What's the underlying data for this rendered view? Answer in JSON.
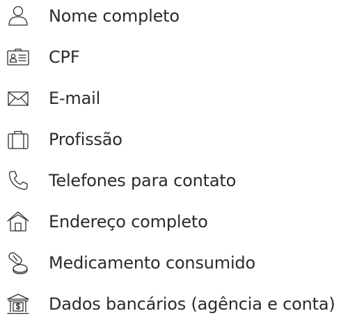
{
  "items": [
    {
      "label": "Nome completo",
      "icon": "user-icon"
    },
    {
      "label": "CPF",
      "icon": "id-card-icon"
    },
    {
      "label": "E-mail",
      "icon": "envelope-icon"
    },
    {
      "label": "Profissão",
      "icon": "briefcase-icon"
    },
    {
      "label": "Telefones para contato",
      "icon": "phone-icon"
    },
    {
      "label": "Endereço completo",
      "icon": "house-icon"
    },
    {
      "label": "Medicamento consumido",
      "icon": "pills-icon"
    },
    {
      "label": "Dados bancários (agência e conta)",
      "icon": "bank-icon"
    }
  ],
  "colors": {
    "text": "#2b2b2b",
    "icon": "#2b2b2b",
    "background": "#ffffff"
  }
}
